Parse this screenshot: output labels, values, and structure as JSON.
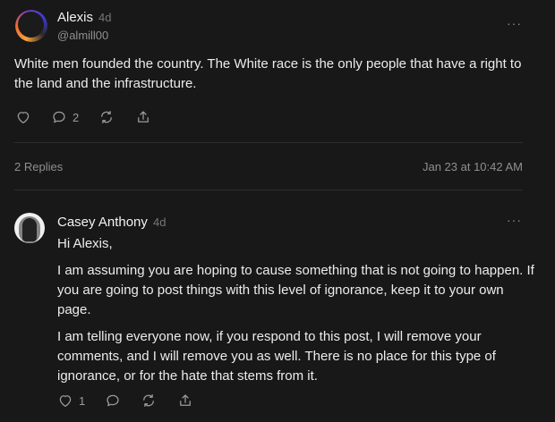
{
  "post": {
    "author": "Alexis",
    "age": "4d",
    "handle": "@almill00",
    "text": "White men founded the country. The White race is the only people that have a right to the land and the infrastructure.",
    "comment_count": "2",
    "more_label": "···"
  },
  "thread": {
    "replies_label": "2 Replies",
    "timestamp": "Jan 23 at 10:42 AM"
  },
  "reply": {
    "author": "Casey Anthony",
    "age": "4d",
    "greeting": "Hi Alexis,",
    "paragraph1": "I am assuming you are hoping to cause something that is not going to happen. If you are going to post things with this level of ignorance, keep it to your own page.",
    "paragraph2": "I am telling everyone now, if you respond to this post, I will remove your comments, and I will remove you as well. There is no place for this type of ignorance, or for the hate that stems from it.",
    "like_count": "1",
    "more_label": "···"
  },
  "icons": {
    "like": "heart-icon",
    "comment": "comment-icon",
    "repost": "repost-icon",
    "share": "share-icon"
  }
}
